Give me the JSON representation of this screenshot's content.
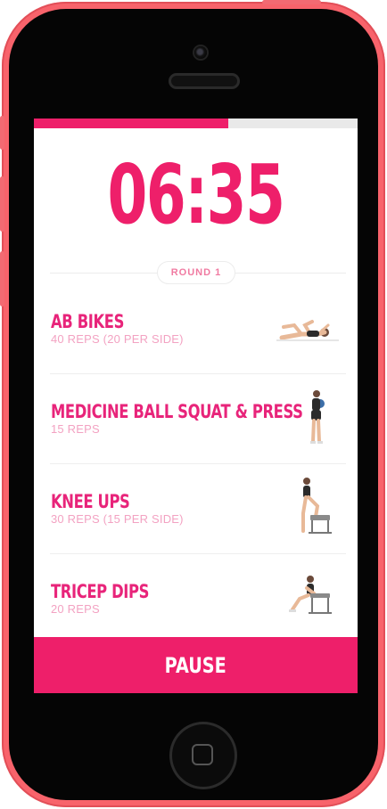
{
  "workout": {
    "timer": "06:35",
    "progress_fraction": 0.6,
    "round_label": "ROUND 1",
    "exercises": [
      {
        "name": "AB BIKES",
        "reps": "40 REPS (20 PER SIDE)",
        "icon": "ab-bikes-illustration"
      },
      {
        "name": "MEDICINE BALL SQUAT & PRESS",
        "reps": "15 REPS",
        "icon": "squat-press-illustration"
      },
      {
        "name": "KNEE UPS",
        "reps": "30 REPS (15 PER SIDE)",
        "icon": "knee-ups-illustration"
      },
      {
        "name": "TRICEP DIPS",
        "reps": "20 REPS",
        "icon": "tricep-dips-illustration"
      }
    ],
    "pause_label": "PAUSE"
  },
  "colors": {
    "accent": "#ee1f6a",
    "phone_body": "#f8636b",
    "reps_text": "#f3a2c2"
  }
}
